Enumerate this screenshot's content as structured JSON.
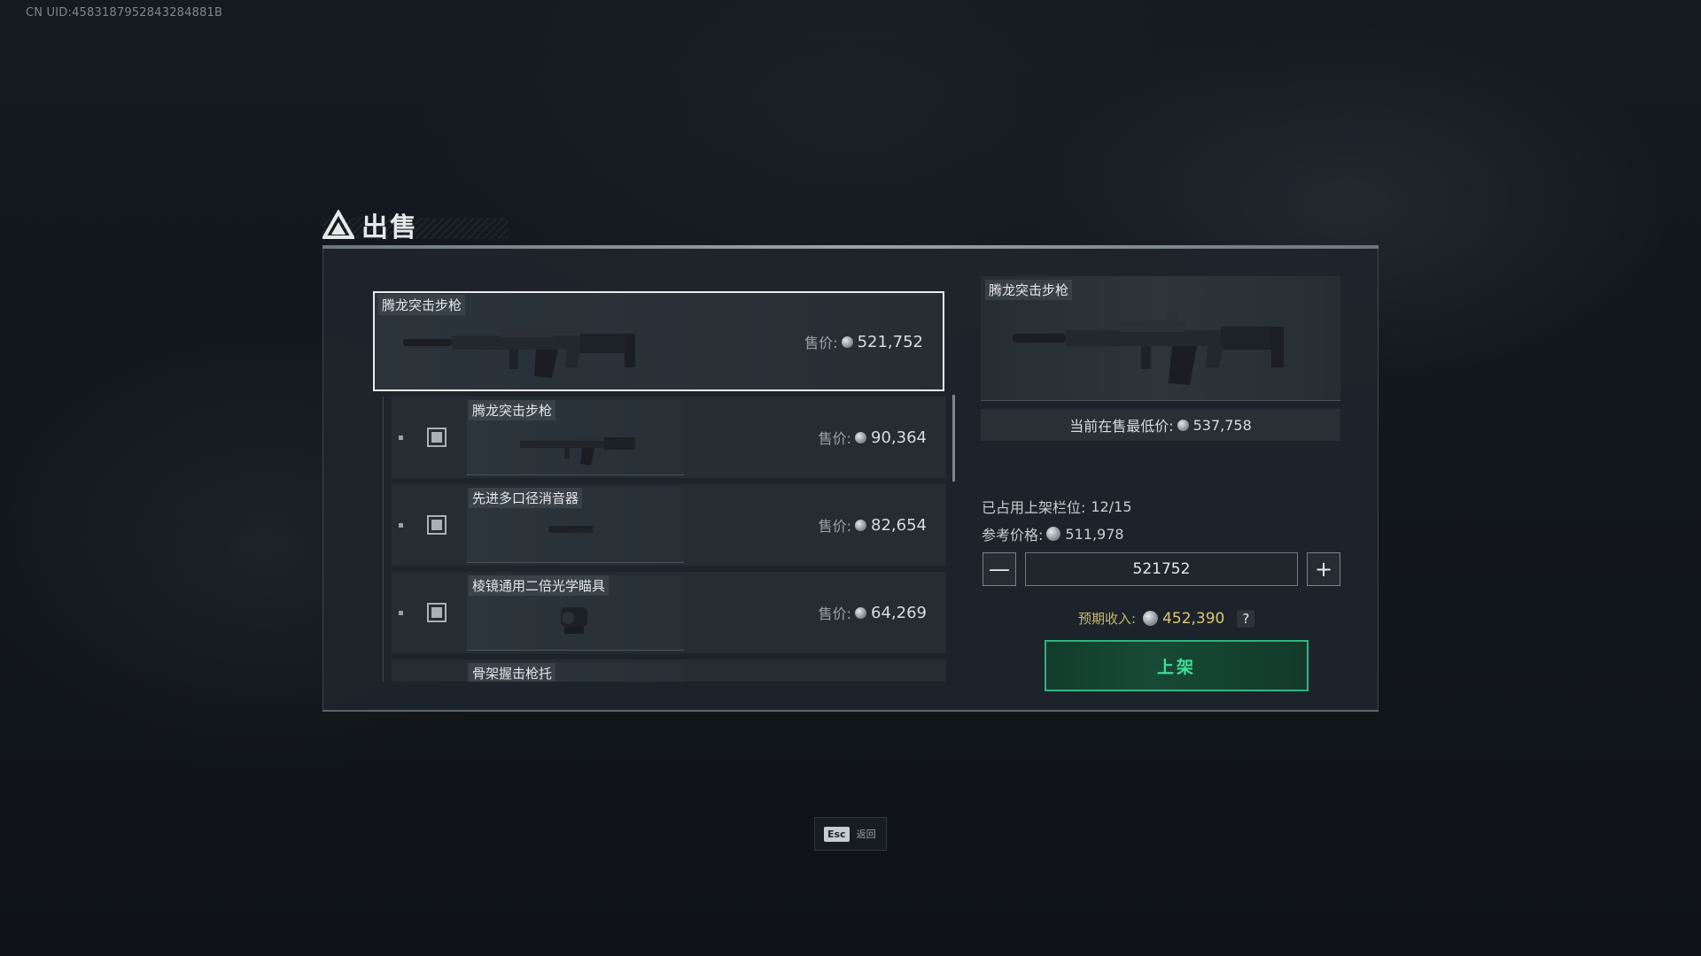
{
  "uid": "CN UID:4583187952843284881B",
  "header": {
    "title": "出售"
  },
  "selected": {
    "name": "腾龙突击步枪",
    "price_label": "售价:",
    "price": "521,752"
  },
  "list": [
    {
      "name": "腾龙突击步枪",
      "price_label": "售价:",
      "price": "90,364",
      "icon": "rifle-icon"
    },
    {
      "name": "先进多口径消音器",
      "price_label": "售价:",
      "price": "82,654",
      "icon": "suppressor-icon"
    },
    {
      "name": "棱镜通用二倍光学瞄具",
      "price_label": "售价:",
      "price": "64,269",
      "icon": "scope-icon"
    },
    {
      "name": "骨架握击枪托",
      "price_label": "",
      "price": "",
      "icon": "stock-icon"
    }
  ],
  "detail": {
    "name": "腾龙突击步枪",
    "lowest_label": "当前在售最低价:",
    "lowest_price": "537,758",
    "slots_label": "已占用上架栏位:",
    "slots_value": "12/15",
    "ref_label": "参考价格:",
    "ref_price": "511,978",
    "input_value": "521752",
    "minus": "—",
    "plus": "+",
    "expected_label": "预期收入:",
    "expected_value": "452,390",
    "help": "?",
    "list_button": "上架"
  },
  "footer": {
    "esc_key": "Esc",
    "esc_text": "返回"
  },
  "colors": {
    "accent_green": "#2fb57e",
    "gold": "#d8c877"
  }
}
